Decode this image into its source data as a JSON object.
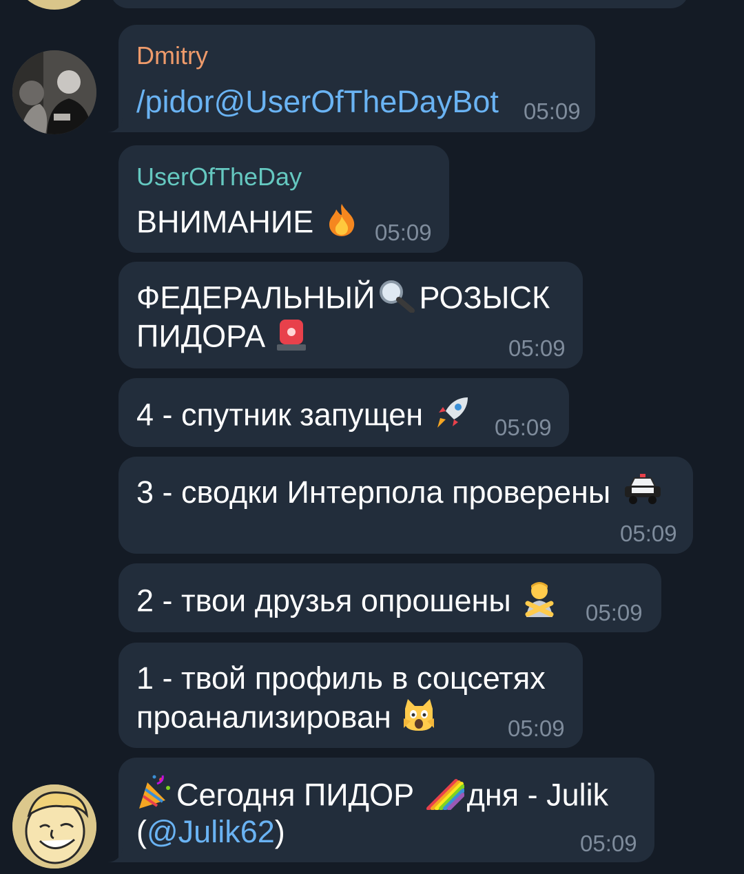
{
  "chat": {
    "top_partial_message": {
      "sender": ""
    },
    "messages": [
      {
        "sender": "Dmitry",
        "sender_color": "#ef9b6b",
        "text": "/pidor@UserOfTheDayBot",
        "time": "05:09"
      },
      {
        "sender": "UserOfTheDay",
        "sender_color": "#65c8c0",
        "text": "ВНИМАНИЕ",
        "emoji": "fire-icon",
        "time": "05:09"
      },
      {
        "line1_a": "ФЕДЕРАЛЬНЫЙ",
        "line1_b": "РОЗЫСК",
        "line2": "ПИДОРА",
        "emoji_1": "magnifier-icon",
        "emoji_2": "siren-icon",
        "time": "05:09"
      },
      {
        "text": "4 - спутник запущен",
        "emoji": "rocket-icon",
        "time": "05:09"
      },
      {
        "text": "3 - сводки Интерпола проверены",
        "emoji": "police-car-icon",
        "time": "05:09"
      },
      {
        "text": "2 - твои друзья опрошены",
        "emoji": "person-gesturing-no-icon",
        "time": "05:09"
      },
      {
        "line1": "1 - твой профиль в соцсетях",
        "line2": "проанализирован",
        "emoji": "weary-cat-icon",
        "time": "05:09"
      },
      {
        "text_a": "Сегодня ПИДОР",
        "text_b": "дня -  Julik",
        "open_paren": "(",
        "mention": "@Julik62",
        "close_paren": ")",
        "emoji_1": "party-popper-icon",
        "emoji_2": "rainbow-icon",
        "time": "05:09"
      }
    ],
    "avatars": {
      "dmitry": "",
      "bot": ""
    },
    "colors": {
      "background": "#141b25",
      "bubble": "#222d3b",
      "link": "#6ab3f3",
      "timestamp": "#7f8c9c"
    }
  }
}
